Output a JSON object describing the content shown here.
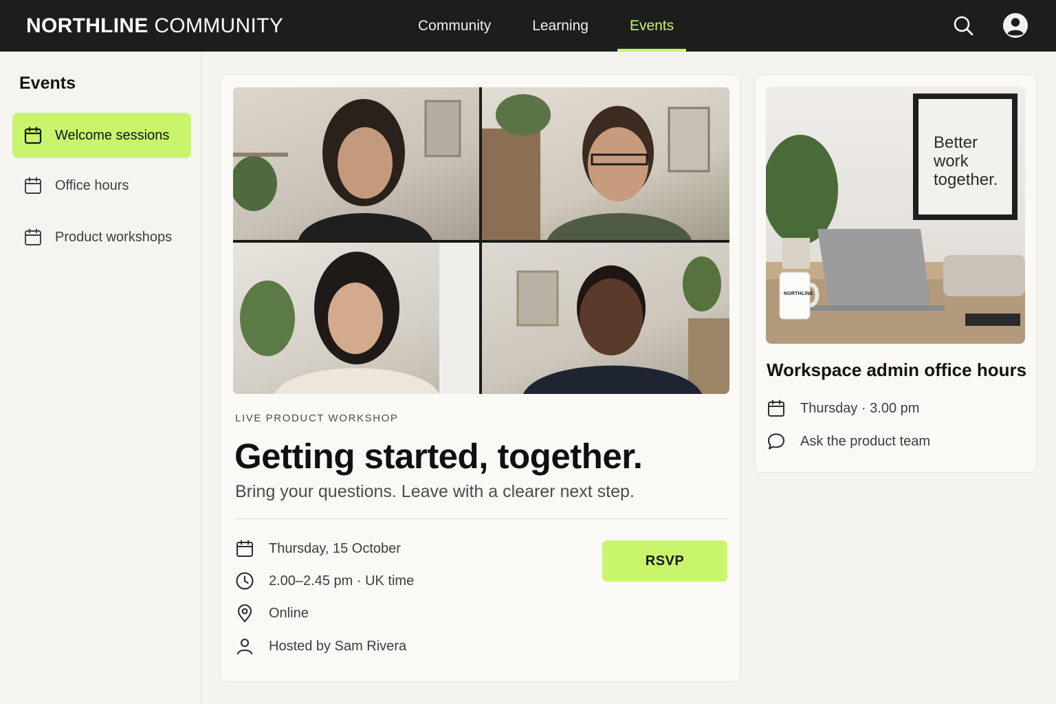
{
  "brand": {
    "bold": "NORTHLINE",
    "light": "COMMUNITY"
  },
  "nav": {
    "items": [
      {
        "label": "Community",
        "active": false
      },
      {
        "label": "Learning",
        "active": false
      },
      {
        "label": "Events",
        "active": true
      }
    ]
  },
  "header_icons": [
    "search-icon",
    "account-icon"
  ],
  "sidebar": {
    "title": "Events",
    "items": [
      {
        "label": "Welcome sessions",
        "icon": "calendar-icon",
        "active": true
      },
      {
        "label": "Office hours",
        "icon": "calendar-icon",
        "active": false
      },
      {
        "label": "Product workshops",
        "icon": "calendar-icon",
        "active": false
      }
    ]
  },
  "featured_event": {
    "eyebrow": "LIVE PRODUCT WORKSHOP",
    "title": "Getting started, together.",
    "subtitle": "Bring your questions. Leave with a clearer next step.",
    "date": "Thursday, 15 October",
    "time": "2.00–2.45 pm · UK time",
    "location": "Online",
    "host": "Hosted by Sam Rivera",
    "rsvp_label": "RSVP"
  },
  "side_event": {
    "poster_text": "Better work together.",
    "mug_text": "NORTHLINE",
    "title": "Workspace admin office hours",
    "when": "Thursday · 3.00 pm",
    "ask": "Ask the product team"
  },
  "colors": {
    "topbar_bg": "#1c1e1c",
    "accent": "#c9f56d",
    "nav_active": "#c6f56c",
    "page_bg": "#f4f3ef"
  }
}
